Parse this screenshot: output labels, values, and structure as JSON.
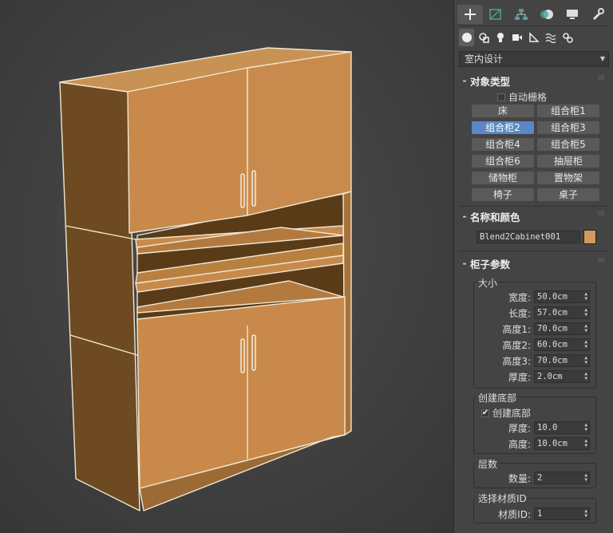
{
  "tabs": [
    "create-icon",
    "modify-icon",
    "hierarchy-icon",
    "motion-icon",
    "display-icon",
    "utilities-icon"
  ],
  "subtabs": [
    "geometry-icon",
    "shapes-icon",
    "lights-icon",
    "cameras-icon",
    "helpers-icon",
    "spacewarps-icon",
    "systems-icon"
  ],
  "category_dropdown": {
    "value": "室内设计"
  },
  "object_type": {
    "title": "对象类型",
    "autogrid_label": "自动栅格",
    "buttons": [
      "床",
      "组合柜1",
      "组合柜2",
      "组合柜3",
      "组合柜4",
      "组合柜5",
      "组合柜6",
      "抽屉柜",
      "储物柜",
      "置物架",
      "椅子",
      "桌子"
    ],
    "selected_button": "组合柜2"
  },
  "name_color": {
    "title": "名称和颜色",
    "object_name": "Blend2Cabinet001",
    "color": "#d49a5b"
  },
  "cabinet_params": {
    "title": "柜子参数",
    "size_group": {
      "title": "大小",
      "rows": [
        {
          "label": "宽度:",
          "value": "50.0cm"
        },
        {
          "label": "长度:",
          "value": "57.0cm"
        },
        {
          "label": "高度1:",
          "value": "70.0cm"
        },
        {
          "label": "高度2:",
          "value": "60.0cm"
        },
        {
          "label": "高度3:",
          "value": "70.0cm"
        },
        {
          "label": "厚度:",
          "value": "2.0cm"
        }
      ]
    },
    "base_group": {
      "title": "创建底部",
      "checkbox_label": "创建底部",
      "checked": true,
      "rows": [
        {
          "label": "厚度:",
          "value": "10.0"
        },
        {
          "label": "高度:",
          "value": "10.0cm"
        }
      ]
    },
    "layers_group": {
      "title": "层数",
      "rows": [
        {
          "label": "数量:",
          "value": "2"
        }
      ]
    },
    "material_group": {
      "title": "选择材质ID",
      "rows": [
        {
          "label": "材质ID:",
          "value": "1"
        }
      ]
    }
  }
}
